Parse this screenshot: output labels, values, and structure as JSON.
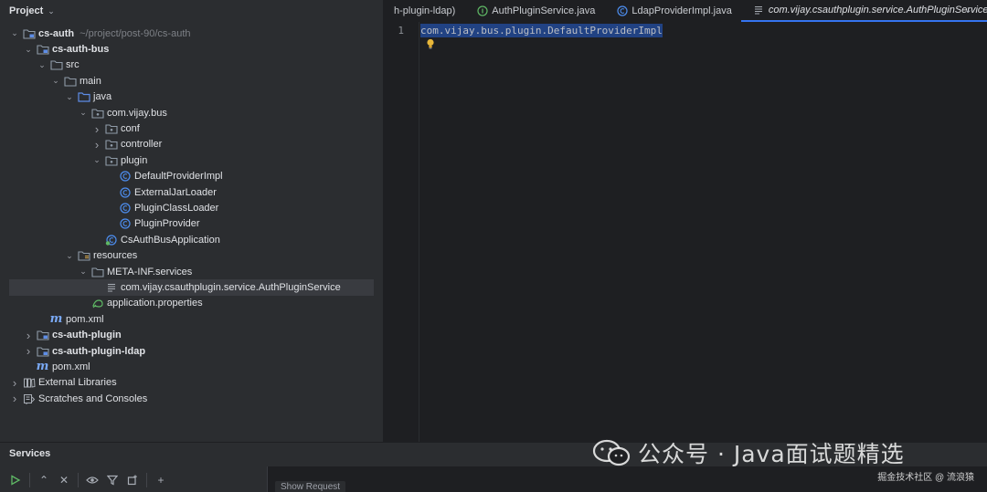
{
  "project_panel": {
    "title": "Project",
    "tree": [
      {
        "label": "cs-auth",
        "path": "~/project/post-90/cs-auth",
        "depth": 0,
        "arrow": "open",
        "icon": "module-folder",
        "bold": true
      },
      {
        "label": "cs-auth-bus",
        "depth": 1,
        "arrow": "open",
        "icon": "module-folder",
        "bold": true
      },
      {
        "label": "src",
        "depth": 2,
        "arrow": "open",
        "icon": "folder"
      },
      {
        "label": "main",
        "depth": 3,
        "arrow": "open",
        "icon": "folder"
      },
      {
        "label": "java",
        "depth": 4,
        "arrow": "open",
        "icon": "source-folder"
      },
      {
        "label": "com.vijay.bus",
        "depth": 5,
        "arrow": "open",
        "icon": "package"
      },
      {
        "label": "conf",
        "depth": 6,
        "arrow": "closed",
        "icon": "package"
      },
      {
        "label": "controller",
        "depth": 6,
        "arrow": "closed",
        "icon": "package"
      },
      {
        "label": "plugin",
        "depth": 6,
        "arrow": "open",
        "icon": "package"
      },
      {
        "label": "DefaultProviderImpl",
        "depth": 7,
        "arrow": "none",
        "icon": "class"
      },
      {
        "label": "ExternalJarLoader",
        "depth": 7,
        "arrow": "none",
        "icon": "class"
      },
      {
        "label": "PluginClassLoader",
        "depth": 7,
        "arrow": "none",
        "icon": "class"
      },
      {
        "label": "PluginProvider",
        "depth": 7,
        "arrow": "none",
        "icon": "class"
      },
      {
        "label": "CsAuthBusApplication",
        "depth": 6,
        "arrow": "none",
        "icon": "spring-class"
      },
      {
        "label": "resources",
        "depth": 4,
        "arrow": "open",
        "icon": "resources-folder"
      },
      {
        "label": "META-INF.services",
        "depth": 5,
        "arrow": "open",
        "icon": "folder"
      },
      {
        "label": "com.vijay.csauthplugin.service.AuthPluginService",
        "depth": 6,
        "arrow": "none",
        "icon": "text-file",
        "selected": true
      },
      {
        "label": "application.properties",
        "depth": 5,
        "arrow": "none",
        "icon": "properties"
      },
      {
        "label": "pom.xml",
        "depth": 2,
        "arrow": "none",
        "icon": "maven"
      },
      {
        "label": "cs-auth-plugin",
        "depth": 1,
        "arrow": "closed",
        "icon": "module-folder",
        "bold": true
      },
      {
        "label": "cs-auth-plugin-ldap",
        "depth": 1,
        "arrow": "closed",
        "icon": "module-folder",
        "bold": true
      },
      {
        "label": "pom.xml",
        "depth": 1,
        "arrow": "none",
        "icon": "maven"
      },
      {
        "label": "External Libraries",
        "depth": 0,
        "arrow": "closed",
        "icon": "libraries"
      },
      {
        "label": "Scratches and Consoles",
        "depth": 0,
        "arrow": "closed",
        "icon": "scratches"
      }
    ]
  },
  "editor": {
    "tabs": [
      {
        "label": "h-plugin-ldap)",
        "icon": "none"
      },
      {
        "label": "AuthPluginService.java",
        "icon": "interface"
      },
      {
        "label": "LdapProviderImpl.java",
        "icon": "class"
      },
      {
        "label": "com.vijay.csauthplugin.service.AuthPluginService",
        "icon": "text-file",
        "active": true,
        "close": "×"
      }
    ],
    "menu_icon": "chevron-down-icon",
    "line_number": "1",
    "code_line": "com.vijay.bus.plugin.DefaultProviderImpl"
  },
  "services": {
    "title": "Services",
    "show_request": "Show Request"
  },
  "watermark": {
    "main": "公众号 · Java面试题精选",
    "sub": "掘金技术社区 @ 流浪猿"
  },
  "colors": {
    "folder": "#8f9ba8",
    "source": "#5e8de6",
    "class": "#4d8ef0",
    "spring": "#5fb865",
    "maven": "#7aa9f5",
    "selection": "#214283",
    "accent": "#3574f0"
  }
}
